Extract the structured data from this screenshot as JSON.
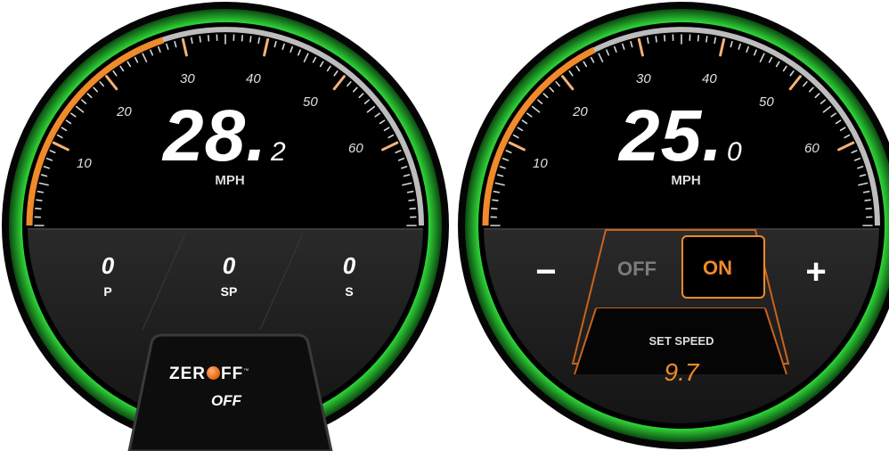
{
  "colors": {
    "accent": "#f08a2a",
    "ring": "#27c22e",
    "bezel": "#c7c7c7",
    "background": "#000000"
  },
  "left_gauge": {
    "speed_main": "28.",
    "speed_decimal": "2",
    "unit": "MPH",
    "speed_value": 28.2,
    "tick_labels": [
      "10",
      "20",
      "30",
      "40",
      "50",
      "60"
    ],
    "trim": [
      {
        "value": "0",
        "label": "P"
      },
      {
        "value": "0",
        "label": "SP"
      },
      {
        "value": "0",
        "label": "S"
      }
    ],
    "logo": {
      "prefix": "ZER",
      "suffix": "FF",
      "tm": "™"
    },
    "logo_state": "OFF"
  },
  "right_gauge": {
    "speed_main": "25.",
    "speed_decimal": "0",
    "unit": "MPH",
    "speed_value": 25.0,
    "tick_labels": [
      "10",
      "20",
      "30",
      "40",
      "50",
      "60"
    ],
    "minus_label": "−",
    "plus_label": "+",
    "off_label": "OFF",
    "on_label": "ON",
    "set_speed_label": "SET SPEED",
    "set_speed_value": "9.7"
  }
}
